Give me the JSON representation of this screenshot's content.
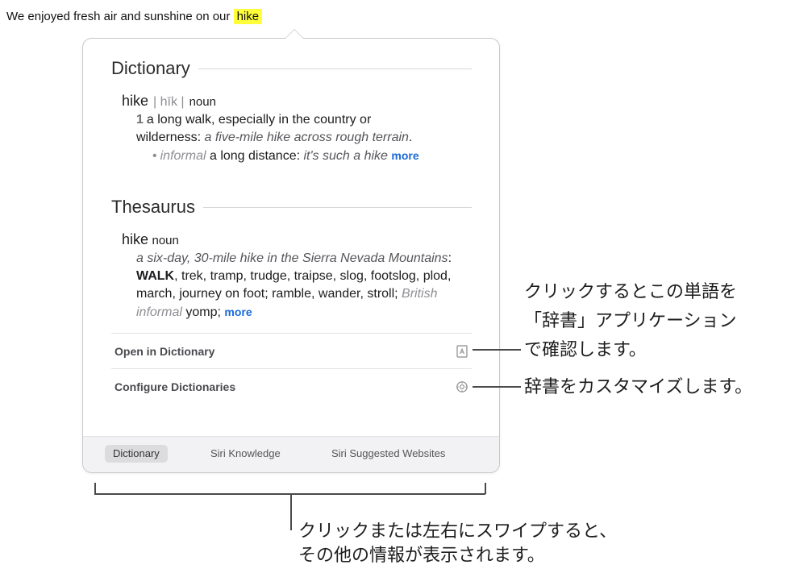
{
  "sentence": {
    "text": "We enjoyed fresh air and sunshine on our ",
    "highlight": "hike"
  },
  "dictionary": {
    "heading": "Dictionary",
    "headword": "hike",
    "pronunciation": "| hīk |",
    "pos": "noun",
    "sense_number": "1",
    "sense_text": "a long walk, especially in the country or wilderness:",
    "sense_example": "a five-mile hike across rough terrain",
    "sense_end": ".",
    "sub_label": "informal",
    "sub_text": "a long distance:",
    "sub_example": "it's such a hike",
    "more": "more"
  },
  "thesaurus": {
    "heading": "Thesaurus",
    "headword": "hike",
    "pos": "noun",
    "example": "a six-day, 30-mile hike in the Sierra Nevada Mountains",
    "colon": ":",
    "first_syn": "WALK",
    "synonyms": ", trek, tramp, trudge, traipse, slog, footslog, plod, march, journey on foot; ramble, wander, stroll;",
    "british_label": "British informal",
    "british_word": "yomp;",
    "more": "more"
  },
  "actions": {
    "open_in_dictionary": "Open in Dictionary",
    "configure_dictionaries": "Configure Dictionaries",
    "open_icon": "dictionary-book-icon",
    "configure_icon": "gear-icon"
  },
  "tabs": [
    {
      "label": "Dictionary",
      "active": true
    },
    {
      "label": "Siri Knowledge",
      "active": false
    },
    {
      "label": "Siri Suggested Websites",
      "active": false
    }
  ],
  "callouts": {
    "open_line1": "クリックするとこの単語を",
    "open_line2": "「辞書」アプリケーション",
    "open_line3": "で確認します。",
    "configure": "辞書をカスタマイズします。",
    "tabs_line1": "クリックまたは左右にスワイプすると、",
    "tabs_line2": "その他の情報が表示されます。"
  }
}
